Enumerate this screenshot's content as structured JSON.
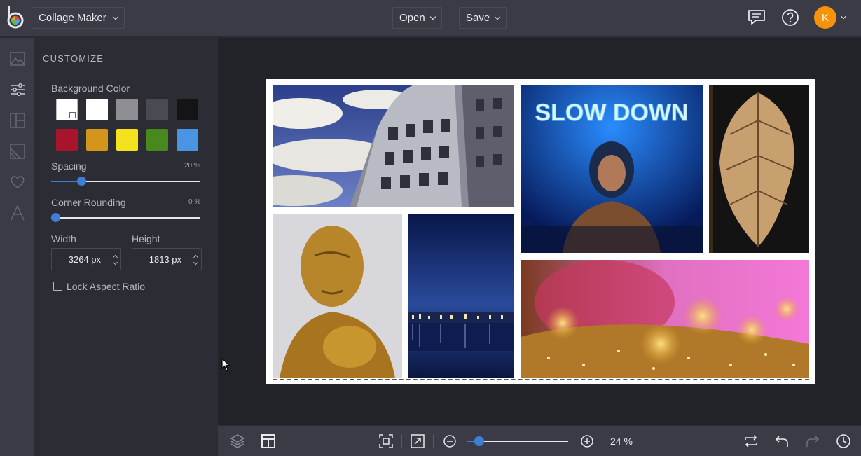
{
  "header": {
    "app_name": "Collage Maker",
    "open_label": "Open",
    "save_label": "Save",
    "avatar_initial": "K",
    "avatar_color": "#f7920b"
  },
  "sidebar": {
    "items": [
      {
        "name": "photos",
        "icon": "image-icon"
      },
      {
        "name": "customize",
        "icon": "sliders-icon",
        "active": true
      },
      {
        "name": "layouts",
        "icon": "layout-icon"
      },
      {
        "name": "backgrounds",
        "icon": "background-icon"
      },
      {
        "name": "graphics",
        "icon": "heart-icon"
      },
      {
        "name": "text",
        "icon": "text-icon"
      }
    ]
  },
  "panel": {
    "title": "CUSTOMIZE",
    "background_color_label": "Background Color",
    "swatches": [
      "#ffffff",
      "#ffffff",
      "#8e8e93",
      "#4a4a52",
      "#141416",
      "#a8142c",
      "#d4961a",
      "#f4e21e",
      "#47891e",
      "#4a94e4"
    ],
    "selected_swatch": 0,
    "spacing_label": "Spacing",
    "spacing_value": "20 %",
    "spacing_fraction": 0.2,
    "corner_label": "Corner Rounding",
    "corner_value": "0 %",
    "corner_fraction": 0.0,
    "width_label": "Width",
    "width_value": "3264 px",
    "height_label": "Height",
    "height_value": "1813 px",
    "lock_label": "Lock Aspect Ratio",
    "lock_checked": false
  },
  "footer": {
    "zoom_value": "24 %",
    "zoom_fraction": 0.12
  }
}
